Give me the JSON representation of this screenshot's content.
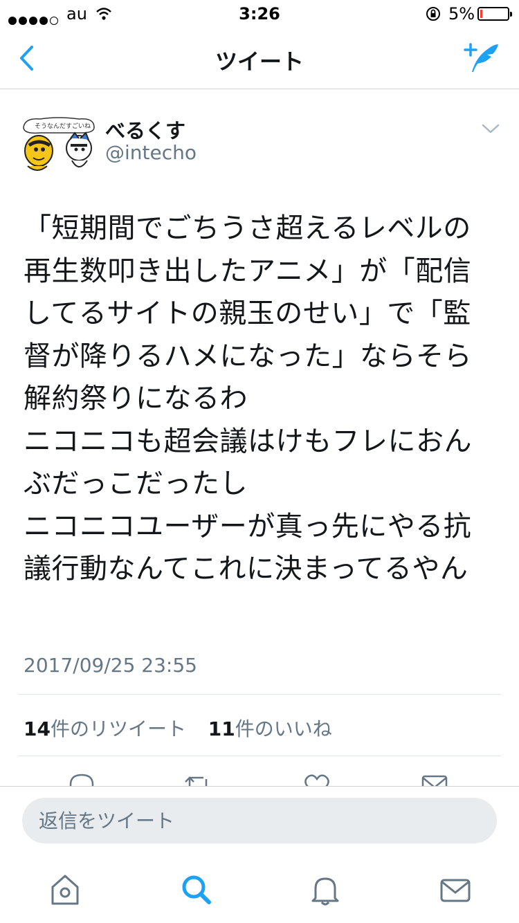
{
  "status_bar": {
    "carrier": "au",
    "time": "3:26",
    "battery_percent": "5%"
  },
  "nav": {
    "title": "ツイート"
  },
  "tweet": {
    "display_name": "べるくす",
    "handle": "@intecho",
    "avatar_caption": "そうなんだすごいね",
    "text": "「短期間でごちうさ超えるレベルの再生数叩き出したアニメ」が「配信してるサイトの親玉のせい」で「監督が降りるハメになった」ならそら解約祭りになるわ\nニコニコも超会議はけもフレにおんぶだっこだったし\nニコニコユーザーが真っ先にやる抗議行動なんてこれに決まってるやん",
    "timestamp": "2017/09/25 23:55",
    "retweet_count": "14",
    "retweet_label": "件のリツイート",
    "like_count": "11",
    "like_label": "件のいいね"
  },
  "reply": {
    "placeholder": "返信をツイート"
  },
  "colors": {
    "accent": "#1da1f2",
    "text": "#14171a",
    "muted": "#657786",
    "battery_low": "#ff3b30"
  }
}
